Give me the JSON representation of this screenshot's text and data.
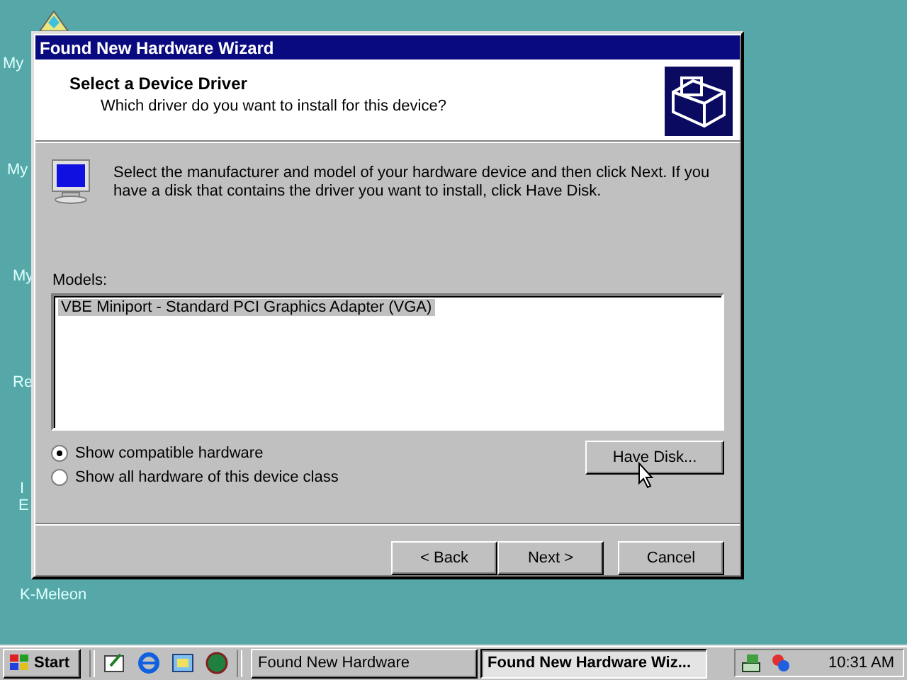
{
  "desktop": {
    "icons": [
      {
        "label": "My"
      },
      {
        "label": "My"
      },
      {
        "label": "My"
      },
      {
        "label": "Re"
      },
      {
        "label": "I"
      },
      {
        "label": "E"
      },
      {
        "label": "K-Meleon"
      }
    ]
  },
  "window": {
    "title": "Found New Hardware Wizard",
    "header": {
      "title": "Select a Device Driver",
      "subtitle": "Which driver do you want to install for this device?"
    },
    "intro": "Select the manufacturer and model of your hardware device and then click Next. If you have a disk that contains the driver you want to install, click Have Disk.",
    "models": {
      "label": "Models:",
      "items": [
        {
          "label": "VBE Miniport - Standard PCI Graphics Adapter (VGA)",
          "selected": true
        }
      ]
    },
    "options": [
      {
        "label": "Show compatible hardware",
        "selected": true
      },
      {
        "label": "Show all hardware of this device class",
        "selected": false
      }
    ],
    "have_disk": "Have Disk...",
    "buttons": [
      "< Back",
      "Next >",
      "Cancel"
    ]
  },
  "taskbar": {
    "start": "Start",
    "tasks": [
      {
        "label": "Found New Hardware",
        "selected": false
      },
      {
        "label": "Found New Hardware Wiz...",
        "selected": true
      }
    ],
    "clock": "10:31 AM"
  }
}
